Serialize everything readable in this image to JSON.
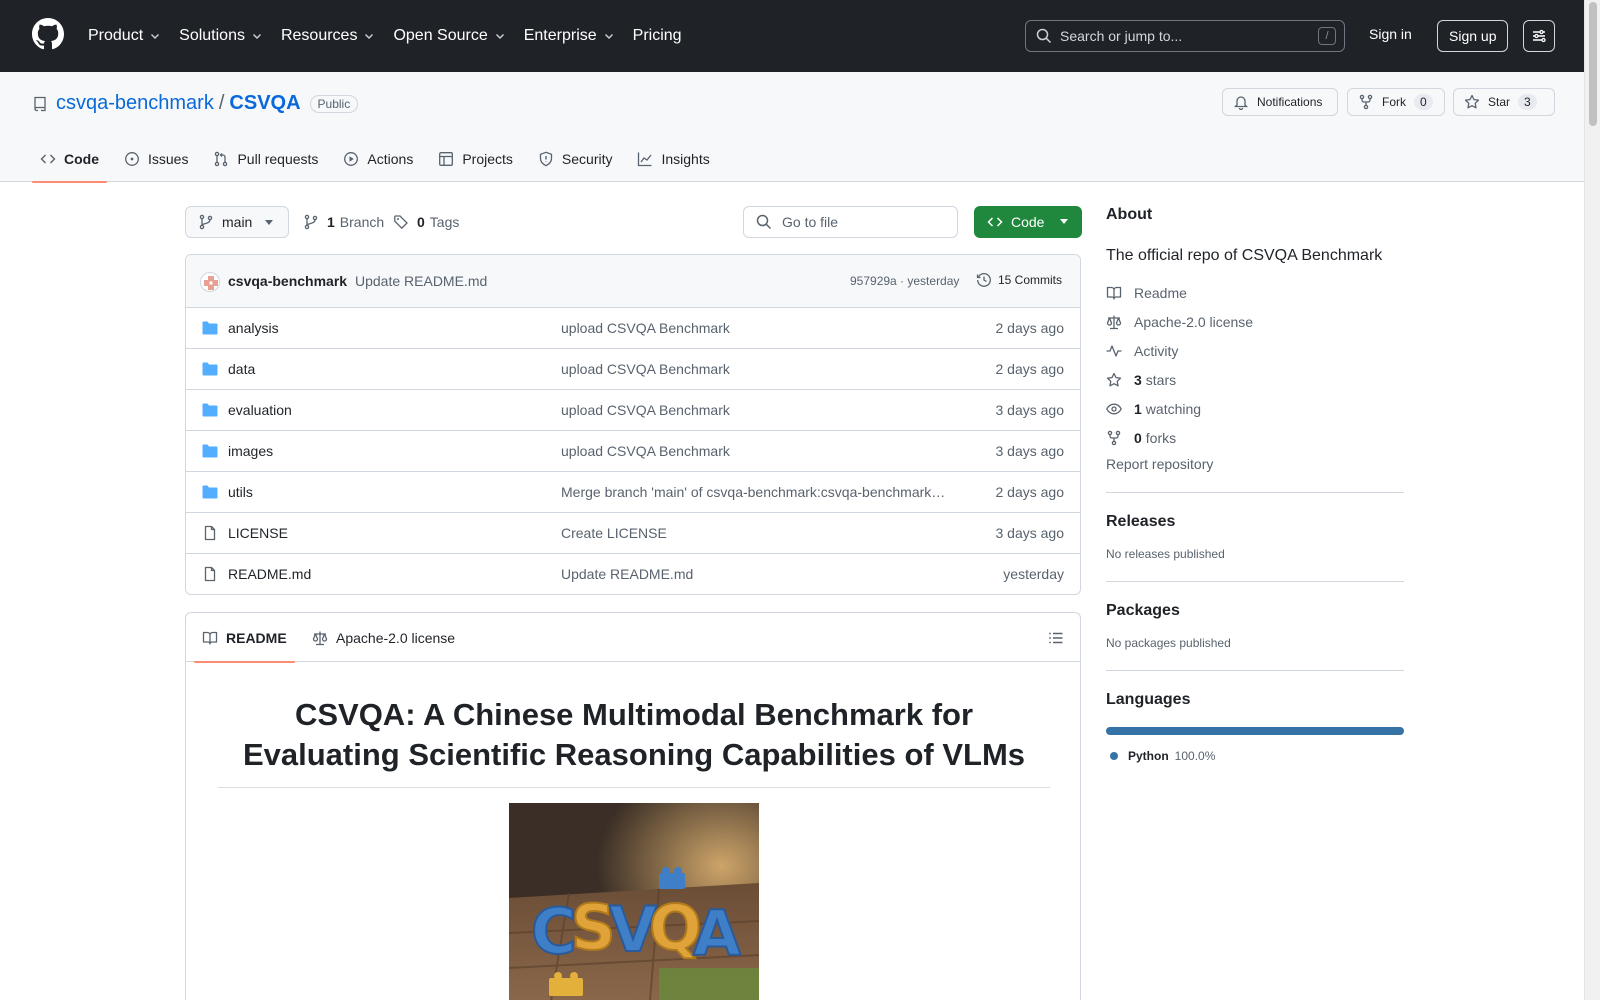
{
  "header": {
    "nav": [
      {
        "label": "Product",
        "dropdown": true
      },
      {
        "label": "Solutions",
        "dropdown": true
      },
      {
        "label": "Resources",
        "dropdown": true
      },
      {
        "label": "Open Source",
        "dropdown": true
      },
      {
        "label": "Enterprise",
        "dropdown": true
      },
      {
        "label": "Pricing",
        "dropdown": false
      }
    ],
    "search_placeholder": "Search or jump to...",
    "search_shortcut": "/",
    "sign_in": "Sign in",
    "sign_up": "Sign up"
  },
  "repo": {
    "owner": "csvqa-benchmark",
    "separator": "/",
    "name": "CSVQA",
    "visibility": "Public",
    "notifications_label": "Notifications",
    "fork_label": "Fork",
    "fork_count": "0",
    "star_label": "Star",
    "star_count": "3"
  },
  "tabs": [
    {
      "label": "Code",
      "icon": "code-icon",
      "active": true
    },
    {
      "label": "Issues",
      "icon": "issue-icon",
      "active": false
    },
    {
      "label": "Pull requests",
      "icon": "pull-request-icon",
      "active": false
    },
    {
      "label": "Actions",
      "icon": "play-icon",
      "active": false
    },
    {
      "label": "Projects",
      "icon": "table-icon",
      "active": false
    },
    {
      "label": "Security",
      "icon": "shield-icon",
      "active": false
    },
    {
      "label": "Insights",
      "icon": "graph-icon",
      "active": false
    }
  ],
  "branchbar": {
    "branch": "main",
    "branch_count": "1",
    "branch_word": "Branch",
    "tag_count": "0",
    "tag_word": "Tags",
    "goto_placeholder": "Go to file",
    "code_button": "Code"
  },
  "commit": {
    "author": "csvqa-benchmark",
    "message": "Update README.md",
    "meta": "957929a · yesterday",
    "commits": "15 Commits"
  },
  "files": [
    {
      "type": "folder",
      "name": "analysis",
      "message": "upload CSVQA Benchmark",
      "date": "2 days ago"
    },
    {
      "type": "folder",
      "name": "data",
      "message": "upload CSVQA Benchmark",
      "date": "2 days ago"
    },
    {
      "type": "folder",
      "name": "evaluation",
      "message": "upload CSVQA Benchmark",
      "date": "3 days ago"
    },
    {
      "type": "folder",
      "name": "images",
      "message": "upload CSVQA Benchmark",
      "date": "3 days ago"
    },
    {
      "type": "folder",
      "name": "utils",
      "message": "Merge branch 'main' of csvqa-benchmark:csvqa-benchmark…",
      "date": "2 days ago"
    },
    {
      "type": "file",
      "name": "LICENSE",
      "message": "Create LICENSE",
      "date": "3 days ago"
    },
    {
      "type": "file",
      "name": "README.md",
      "message": "Update README.md",
      "date": "yesterday"
    }
  ],
  "readme": {
    "tab_readme": "README",
    "tab_license": "Apache-2.0 license",
    "title": "CSVQA: A Chinese Multimodal Benchmark for Evaluating Scientific Reasoning Capabilities of VLMs",
    "hero_text": "CSVQA"
  },
  "sidebar": {
    "about_title": "About",
    "description": "The official repo of CSVQA Benchmark",
    "items": [
      {
        "icon": "book-icon",
        "strong": "",
        "text": "Readme"
      },
      {
        "icon": "law-icon",
        "strong": "",
        "text": "Apache-2.0 license"
      },
      {
        "icon": "pulse-icon",
        "strong": "",
        "text": "Activity"
      },
      {
        "icon": "star-icon",
        "strong": "3",
        "text": "stars"
      },
      {
        "icon": "eye-icon",
        "strong": "1",
        "text": "watching"
      },
      {
        "icon": "fork-icon",
        "strong": "0",
        "text": "forks"
      }
    ],
    "report": "Report repository",
    "releases_title": "Releases",
    "releases_empty": "No releases published",
    "packages_title": "Packages",
    "packages_empty": "No packages published",
    "languages_title": "Languages",
    "languages": [
      {
        "name": "Python",
        "percent": "100.0%",
        "color": "#3572A5"
      }
    ]
  },
  "colors": {
    "header_bg": "#1f2328",
    "link": "#0969da",
    "code_button": "#1f883d",
    "active_tab": "#fd8c73",
    "folder_icon": "#54aeff"
  }
}
